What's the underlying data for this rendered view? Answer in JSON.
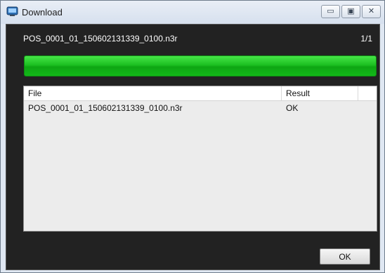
{
  "window": {
    "title": "Download",
    "controls": {
      "minimize": "▭",
      "maximize": "▣",
      "close": "✕"
    }
  },
  "header": {
    "filename": "POS_0001_01_150602131339_0100.n3r",
    "counter": "1/1"
  },
  "progress": {
    "fraction": 1.0,
    "color": "#1cc021"
  },
  "table": {
    "columns": [
      "File",
      "Result"
    ],
    "rows": [
      {
        "file": "POS_0001_01_150602131339_0100.n3r",
        "result": "OK"
      }
    ]
  },
  "footer": {
    "ok_label": "OK"
  }
}
